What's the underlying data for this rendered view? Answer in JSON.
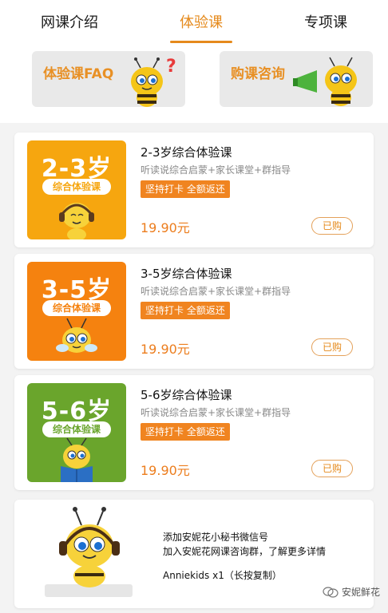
{
  "tabs": [
    {
      "label": "网课介绍"
    },
    {
      "label": "体验课"
    },
    {
      "label": "专项课"
    }
  ],
  "banners": {
    "faq": {
      "label": "体验课FAQ",
      "icon": "bee-question-icon"
    },
    "consult": {
      "label": "购课咨询",
      "icon": "bee-megaphone-icon"
    }
  },
  "courses": [
    {
      "age": "2-3岁",
      "tag": "综合体验课",
      "title": "2-3岁综合体验课",
      "desc": "听读说综合启蒙+家长课堂+群指导",
      "promo": "坚持打卡 全额返还",
      "price": "19.90元",
      "status": "已购",
      "color": "#f6a60f"
    },
    {
      "age": "3-5岁",
      "tag": "综合体验课",
      "title": "3-5岁综合体验课",
      "desc": "听读说综合启蒙+家长课堂+群指导",
      "promo": "坚持打卡 全额返还",
      "price": "19.90元",
      "status": "已购",
      "color": "#f5820f"
    },
    {
      "age": "5-6岁",
      "tag": "综合体验课",
      "title": "5-6岁综合体验课",
      "desc": "听读说综合启蒙+家长课堂+群指导",
      "promo": "坚持打卡 全额返还",
      "price": "19.90元",
      "status": "已购",
      "color": "#6aa52c"
    }
  ],
  "info": {
    "line1": "添加安妮花小秘书微信号",
    "line2": "加入安妮花网课咨询群，了解更多详情",
    "wechat": "Anniekids x1（长按复制）"
  },
  "watermark": "安妮鲜花",
  "colors": {
    "accent": "#e58a1c",
    "price": "#ec7d1d",
    "promo": "#f08420"
  }
}
